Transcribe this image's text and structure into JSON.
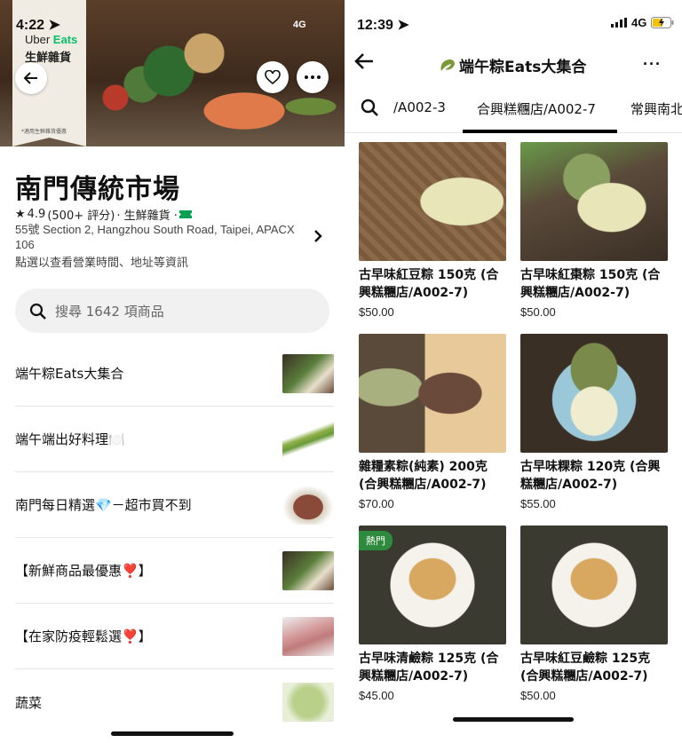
{
  "left": {
    "status": {
      "time": "4:22",
      "network": "4G"
    },
    "hero": {
      "brand_prefix": "Uber ",
      "brand_suffix": "Eats",
      "title": "生鮮雜貨",
      "note": "*適用生鮮雜貨優惠"
    },
    "store": {
      "name": "南門傳統市場",
      "rating": "4.9",
      "review_count": "(500+ 評分)",
      "category": "· 生鮮雜貨 ·",
      "address": "55號 Section 2, Hangzhou South Road, Taipei, APACX 106",
      "info_hint": "點選以查看營業時間、地址等資訊"
    },
    "search": {
      "placeholder": "搜尋 1642 項商品"
    },
    "categories": [
      {
        "label": "端午粽Eats大集合",
        "icon": "leaf-icon",
        "color": "#5a7d3a"
      },
      {
        "label": "端午端出好料理🍽️",
        "color": "#8fb04a"
      },
      {
        "label": "南門每日精選💎－超市買不到",
        "color": "#8a4a3a"
      },
      {
        "label": "【新鮮商品最優惠❣️】",
        "color": "#6a6a55"
      },
      {
        "label": "【在家防疫輕鬆選❣️】",
        "color": "#d49a9a"
      },
      {
        "label": "蔬菜",
        "color": "#b9d08a"
      }
    ]
  },
  "right": {
    "status": {
      "time": "12:39",
      "network": "4G"
    },
    "nav": {
      "title": "端午粽Eats大集合",
      "more": "···"
    },
    "tabs": [
      "/A002-3",
      "合興糕糰店/A002-7",
      "常興南北"
    ],
    "products": [
      {
        "name": "古早味紅豆粽 150克 (合興糕糰店/A002-7)",
        "price": "$50.00",
        "badge": "",
        "bg": "#8a6a4a"
      },
      {
        "name": "古早味紅棗粽 150克 (合興糕糰店/A002-7)",
        "price": "$50.00",
        "badge": "",
        "bg": "#5a4a3a"
      },
      {
        "name": "雜糧素粽(純素) 200克 (合興糕糰店/A002-7)",
        "price": "$70.00",
        "badge": "",
        "bg": "#c9a67a"
      },
      {
        "name": "古早味粿粽 120克 (合興糕糰店/A002-7)",
        "price": "$55.00",
        "badge": "",
        "bg": "#7aaabb"
      },
      {
        "name": "古早味清鹼粽 125克 (合興糕糰店/A002-7)",
        "price": "$45.00",
        "badge": "熱門",
        "bg": "#3a3a30"
      },
      {
        "name": "古早味紅豆鹼粽 125克 (合興糕糰店/A002-7)",
        "price": "$50.00",
        "badge": "",
        "bg": "#3a3a30"
      }
    ]
  }
}
